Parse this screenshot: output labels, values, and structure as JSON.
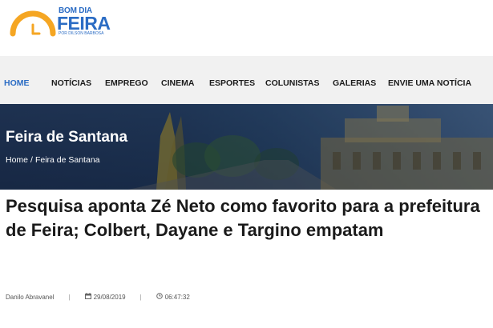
{
  "brand": {
    "line1": "BOM DIA",
    "line2": "FEIRA",
    "tagline": "POR DILSON BARBOSA",
    "accent_orange": "#f5a623",
    "accent_blue": "#2b6cc4"
  },
  "nav": {
    "items": [
      {
        "label": "HOME",
        "active": true
      },
      {
        "label": "NOTÍCIAS"
      },
      {
        "label": "EMPREGO"
      },
      {
        "label": "CINEMA"
      },
      {
        "label": "ESPORTES"
      },
      {
        "label": "COLUNISTAS"
      },
      {
        "label": "GALERIAS"
      },
      {
        "label": "ENVIE UMA NOTÍCIA"
      }
    ]
  },
  "banner": {
    "title": "Feira de Santana",
    "breadcrumb": {
      "home": "Home",
      "separator": "/",
      "current": "Feira de Santana"
    }
  },
  "article": {
    "title": "Pesquisa aponta Zé Neto como favorito para a prefeitura de Feira; Colbert, Dayane e Targino empatam",
    "author": "Danilo Abravanel",
    "date": "29/08/2019",
    "time": "06:47:32",
    "meta_separator": "|",
    "icons": {
      "date": "calendar-icon",
      "time": "clock-icon"
    }
  }
}
